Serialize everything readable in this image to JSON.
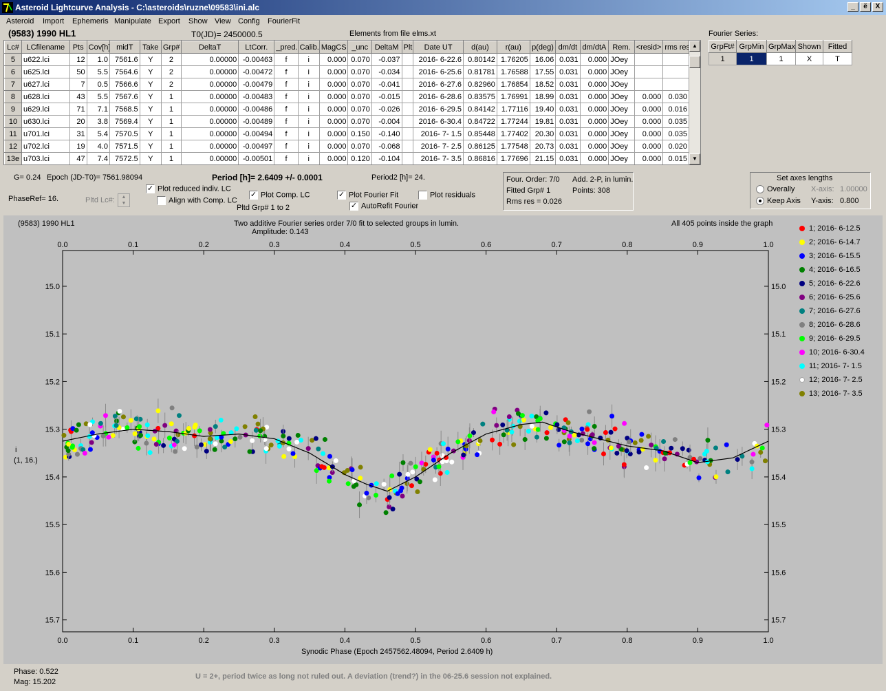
{
  "window": {
    "title": "Asteroid Lightcurve Analysis - C:\\asteroids\\ruzne\\09583\\ini.alc",
    "minimize": "_",
    "restore": "ё",
    "close": "X"
  },
  "menu": [
    "Asteroid",
    "Import",
    "Ephemeris",
    "Manipulate",
    "Export",
    "Show",
    "View",
    "Config",
    "FourierFit"
  ],
  "header": {
    "asteroid": "(9583) 1990 HL1",
    "t0": "T0(JD)= 2450000.5",
    "elements": "Elements from file elms.xt",
    "fourier_title": "Fourier Series:"
  },
  "table": {
    "columns": [
      "Lc#",
      "LCfilename",
      "Pts",
      "Cov[h]",
      "midT",
      "Take",
      "Grp#",
      "DeltaT",
      "LtCorr.",
      "_pred.",
      "Calib.",
      "MagCS",
      "_unc",
      "DeltaM",
      "Plt",
      "Date UT",
      "d(au)",
      "r(au)",
      "p(deg)",
      "dm/dt",
      "dm/dtA",
      "Rem.",
      "<resid>",
      "rms res"
    ],
    "rows": [
      [
        "5",
        "u622.lci",
        "12",
        "1.0",
        "7561.6",
        "Y",
        "2",
        "0.00000",
        "-0.00463",
        "f",
        "i",
        "0.000",
        "0.070",
        "-0.037",
        "",
        "2016- 6-22.6",
        "0.80142",
        "1.76205",
        "16.06",
        "0.031",
        "0.000",
        "JOey",
        "",
        ""
      ],
      [
        "6",
        "u625.lci",
        "50",
        "5.5",
        "7564.6",
        "Y",
        "2",
        "0.00000",
        "-0.00472",
        "f",
        "i",
        "0.000",
        "0.070",
        "-0.034",
        "",
        "2016- 6-25.6",
        "0.81781",
        "1.76588",
        "17.55",
        "0.031",
        "0.000",
        "JOey",
        "",
        ""
      ],
      [
        "7",
        "u627.lci",
        "7",
        "0.5",
        "7566.6",
        "Y",
        "2",
        "0.00000",
        "-0.00479",
        "f",
        "i",
        "0.000",
        "0.070",
        "-0.041",
        "",
        "2016- 6-27.6",
        "0.82960",
        "1.76854",
        "18.52",
        "0.031",
        "0.000",
        "JOey",
        "",
        ""
      ],
      [
        "8",
        "u628.lci",
        "43",
        "5.5",
        "7567.6",
        "Y",
        "1",
        "0.00000",
        "-0.00483",
        "f",
        "i",
        "0.000",
        "0.070",
        "-0.015",
        "",
        "2016- 6-28.6",
        "0.83575",
        "1.76991",
        "18.99",
        "0.031",
        "0.000",
        "JOey",
        "0.000",
        "0.030"
      ],
      [
        "9",
        "u629.lci",
        "71",
        "7.1",
        "7568.5",
        "Y",
        "1",
        "0.00000",
        "-0.00486",
        "f",
        "i",
        "0.000",
        "0.070",
        "-0.026",
        "",
        "2016- 6-29.5",
        "0.84142",
        "1.77116",
        "19.40",
        "0.031",
        "0.000",
        "JOey",
        "0.000",
        "0.016"
      ],
      [
        "10",
        "u630.lci",
        "20",
        "3.8",
        "7569.4",
        "Y",
        "1",
        "0.00000",
        "-0.00489",
        "f",
        "i",
        "0.000",
        "0.070",
        "-0.004",
        "",
        "2016- 6-30.4",
        "0.84722",
        "1.77244",
        "19.81",
        "0.031",
        "0.000",
        "JOey",
        "0.000",
        "0.035"
      ],
      [
        "11",
        "u701.lci",
        "31",
        "5.4",
        "7570.5",
        "Y",
        "1",
        "0.00000",
        "-0.00494",
        "f",
        "i",
        "0.000",
        "0.150",
        "-0.140",
        "",
        "2016- 7- 1.5",
        "0.85448",
        "1.77402",
        "20.30",
        "0.031",
        "0.000",
        "JOey",
        "0.000",
        "0.035"
      ],
      [
        "12",
        "u702.lci",
        "19",
        "4.0",
        "7571.5",
        "Y",
        "1",
        "0.00000",
        "-0.00497",
        "f",
        "i",
        "0.000",
        "0.070",
        "-0.068",
        "",
        "2016- 7- 2.5",
        "0.86125",
        "1.77548",
        "20.73",
        "0.031",
        "0.000",
        "JOey",
        "0.000",
        "0.020"
      ],
      [
        "13e",
        "u703.lci",
        "47",
        "7.4",
        "7572.5",
        "Y",
        "1",
        "0.00000",
        "-0.00501",
        "f",
        "i",
        "0.000",
        "0.120",
        "-0.104",
        "",
        "2016- 7- 3.5",
        "0.86816",
        "1.77696",
        "21.15",
        "0.031",
        "0.000",
        "JOey",
        "0.000",
        "0.015"
      ]
    ]
  },
  "fourier_table": {
    "columns": [
      "GrpFt#",
      "GrpMin",
      "GrpMax",
      "Shown",
      "Fitted"
    ],
    "row": [
      "1",
      "1",
      "1",
      "X",
      "T"
    ]
  },
  "info": {
    "g": "G= 0.24",
    "epoch": "Epoch (JD-T0)= 7561.98094",
    "period": "Period [h]= 2.6409 +/- 0.0001",
    "period2": "Period2 [h]= 24.",
    "phaseref": "PhaseRef= 16.",
    "pltd_lc": "Pltd Lc#:",
    "plot_reduced": "Plot reduced indiv. LC",
    "align": "Align with Comp. LC",
    "plot_comp": "Plot Comp. LC",
    "pltd_grp": "Pltd Grp#  1   to   2",
    "plot_fourier": "Plot Fourier Fit",
    "autorefit": "AutoRefit Fourier",
    "plot_resid": "Plot residuals",
    "check_mark": "✓"
  },
  "fitbox": {
    "order": "Four. Order:  7/0",
    "add": "Add. 2-P, in lumin.",
    "fitted": "Fitted Grp# 1",
    "points": "Points: 308",
    "rms": "Rms res     = 0.026"
  },
  "axes_box": {
    "title": "Set axes lengths",
    "overally": "Overally",
    "keep": "Keep Axis",
    "x_label": "X-axis:",
    "x_val": "1.00000",
    "y_label": "Y-axis:",
    "y_val": "0.800"
  },
  "plot": {
    "name": "(9583) 1990 HL1",
    "subtitle1": "Two additive Fourier series order 7/0 fit to selected groups in lumin.",
    "subtitle2": "Amplitude: 0.143",
    "points_note": "All 405 points inside the graph",
    "ylabel1": "i",
    "ylabel2": "(1, 16.)",
    "xlabel": "Synodic Phase (Epoch 2457562.48094, Period 2.6409 h)"
  },
  "chart_data": {
    "type": "scatter",
    "xlim": [
      0.0,
      1.0
    ],
    "ylim": [
      14.925,
      15.725
    ],
    "y_inverted": true,
    "x_ticks": [
      "0.0",
      "0.1",
      "0.2",
      "0.3",
      "0.4",
      "0.5",
      "0.6",
      "0.7",
      "0.8",
      "0.9",
      "1.0"
    ],
    "y_ticks": [
      "15.0",
      "15.1",
      "15.2",
      "15.3",
      "15.4",
      "15.5",
      "15.6",
      "15.7"
    ],
    "background": "#c0c0c0",
    "fourier_fit": {
      "x": [
        0.0,
        0.05,
        0.1,
        0.15,
        0.2,
        0.25,
        0.3,
        0.35,
        0.4,
        0.43,
        0.46,
        0.5,
        0.55,
        0.6,
        0.65,
        0.68,
        0.72,
        0.76,
        0.8,
        0.85,
        0.9,
        0.95,
        1.0
      ],
      "y": [
        15.325,
        15.31,
        15.3,
        15.305,
        15.315,
        15.31,
        15.32,
        15.35,
        15.395,
        15.415,
        15.43,
        15.4,
        15.35,
        15.31,
        15.29,
        15.285,
        15.305,
        15.32,
        15.335,
        15.345,
        15.37,
        15.36,
        15.325
      ]
    },
    "series": [
      {
        "name": "1; 2016- 6-12.5",
        "color": "#ff0000"
      },
      {
        "name": "2; 2016- 6-14.7",
        "color": "#ffff00"
      },
      {
        "name": "3; 2016- 6-15.5",
        "color": "#0000ff"
      },
      {
        "name": "4; 2016- 6-16.5",
        "color": "#008000"
      },
      {
        "name": "5; 2016- 6-22.6",
        "color": "#000080"
      },
      {
        "name": "6; 2016- 6-25.6",
        "color": "#800080"
      },
      {
        "name": "7; 2016- 6-27.6",
        "color": "#008080"
      },
      {
        "name": "8; 2016- 6-28.6",
        "color": "#808080"
      },
      {
        "name": "9; 2016- 6-29.5",
        "color": "#00ff00"
      },
      {
        "name": "10; 2016- 6-30.4",
        "color": "#ff00ff"
      },
      {
        "name": "11; 2016- 7- 1.5",
        "color": "#00ffff"
      },
      {
        "name": "12; 2016- 7- 2.5",
        "color": "#ffffff"
      },
      {
        "name": "13; 2016- 7- 3.5",
        "color": "#808000"
      }
    ],
    "point_count": 405
  },
  "footer": {
    "phase": "Phase:  0.522",
    "mag": "Mag:   15.202",
    "note": "U = 2+, period twice as long not ruled out.  A deviation (trend?) in the 06-25.6 session not explained."
  }
}
